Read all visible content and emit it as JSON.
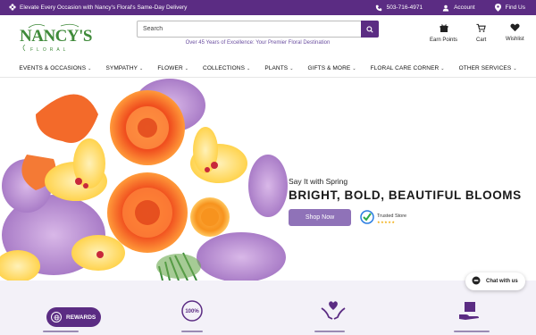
{
  "topbar": {
    "promo": "Elevate Every Occasion with Nancy's Floral's Same-Day Delivery",
    "phone": "503-716-4971",
    "account": "Account",
    "find_us": "Find Us"
  },
  "header": {
    "logo_text": "NANCY'S",
    "logo_sub": "FLORAL",
    "search_placeholder": "Search",
    "tagline": "Over 45 Years of Excellence: Your Premier Floral Destination",
    "earn_points": "Earn Points",
    "cart": "Cart",
    "wishlist": "Wishlist"
  },
  "nav": {
    "items": [
      {
        "label": "EVENTS & OCCASIONS"
      },
      {
        "label": "SYMPATHY"
      },
      {
        "label": "FLOWER"
      },
      {
        "label": "COLLECTIONS"
      },
      {
        "label": "PLANTS"
      },
      {
        "label": "GIFTS & MORE"
      },
      {
        "label": "FLORAL CARE CORNER"
      },
      {
        "label": "OTHER SERVICES"
      }
    ]
  },
  "hero": {
    "subtitle": "Say It with Spring",
    "title": "BRIGHT, BOLD, BEAUTIFUL BLOOMS",
    "cta": "Shop Now",
    "badge": "Trusted Store",
    "badge_stars": "★★★★★"
  },
  "widgets": {
    "rewards": "REWARDS",
    "chat": "Chat with us"
  },
  "features": {
    "badge_100": "100%"
  },
  "colors": {
    "brand_purple": "#5b2c83",
    "button_purple": "#8f72b8",
    "logo_green": "#3f8a3a"
  }
}
